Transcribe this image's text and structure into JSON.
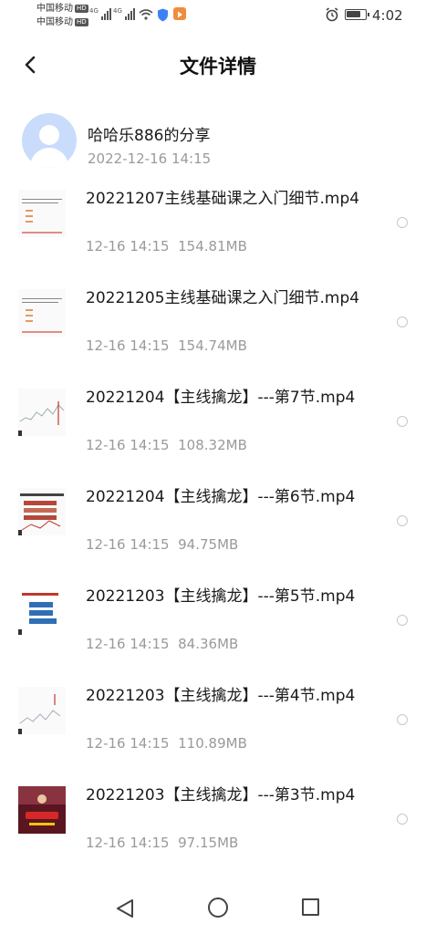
{
  "status_bar": {
    "carrier_1": "中国移动",
    "carrier_2": "中国移动",
    "hd_badge": "HD",
    "network_1": "4G",
    "network_2": "4G",
    "time": "4:02"
  },
  "header": {
    "title": "文件详情"
  },
  "share": {
    "name": "哈哈乐886的分享",
    "time": "2022-12-16  14:15"
  },
  "files": [
    {
      "name": "20221207主线基础课之入门细节.mp4",
      "time": "12-16  14:15",
      "size": "154.81MB",
      "thumb": "doc"
    },
    {
      "name": "20221205主线基础课之入门细节.mp4",
      "time": "12-16  14:15",
      "size": "154.74MB",
      "thumb": "doc"
    },
    {
      "name": "20221204【主线擒龙】---第7节.mp4",
      "time": "12-16  14:15",
      "size": "108.32MB",
      "thumb": "chart"
    },
    {
      "name": "20221204【主线擒龙】---第6节.mp4",
      "time": "12-16  14:15",
      "size": "94.75MB",
      "thumb": "slide"
    },
    {
      "name": "20221203【主线擒龙】---第5节.mp4",
      "time": "12-16  14:15",
      "size": "84.36MB",
      "thumb": "blue"
    },
    {
      "name": "20221203【主线擒龙】---第4节.mp4",
      "time": "12-16  14:15",
      "size": "110.89MB",
      "thumb": "chart"
    },
    {
      "name": "20221203【主线擒龙】---第3节.mp4",
      "time": "12-16  14:15",
      "size": "97.15MB",
      "thumb": "dark"
    }
  ],
  "colors": {
    "secondary_text": "#9a9a9a",
    "avatar_bg": "#c9dcfb"
  }
}
